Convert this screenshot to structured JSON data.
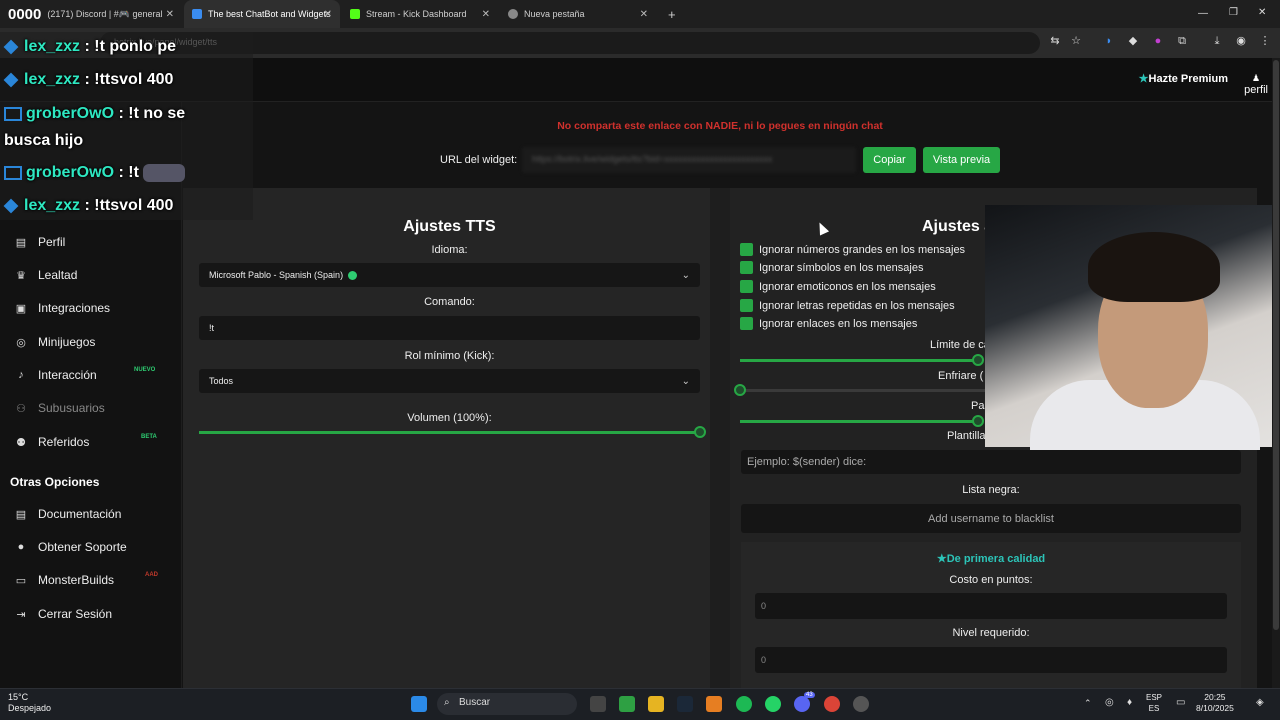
{
  "browser": {
    "tabs": [
      {
        "label": "(2171) Discord | #🎮 general"
      },
      {
        "label": "The best ChatBot and Widgets"
      },
      {
        "label": "Stream - Kick Dashboard"
      },
      {
        "label": "Nueva pestaña"
      }
    ],
    "new_tab_glyph": "+",
    "url": "botrix.live/panel/widget/tts"
  },
  "topnav": {
    "premium_label": "Hazte Premium",
    "profile_label": "perfil"
  },
  "sidebar": {
    "items": [
      {
        "label": "Perfil",
        "icon": "id-card-icon"
      },
      {
        "label": "Lealtad",
        "icon": "trophy-icon"
      },
      {
        "label": "Integraciones",
        "icon": "grid-icon"
      },
      {
        "label": "Minijuegos",
        "icon": "gamepad-icon"
      },
      {
        "label": "Interacción",
        "icon": "music-icon"
      },
      {
        "label": "Subusuarios",
        "icon": "users-icon"
      },
      {
        "label": "Referidos",
        "icon": "referral-icon"
      }
    ],
    "badges": {
      "interaccion": "NUEVO",
      "referidos": "BETA",
      "monsterbuilds": "AAD"
    },
    "section_title": "Otras Opciones",
    "other_items": [
      {
        "label": "Documentación",
        "icon": "document-icon"
      },
      {
        "label": "Obtener Soporte",
        "icon": "support-icon"
      },
      {
        "label": "MonsterBuilds",
        "icon": "monitor-icon"
      },
      {
        "label": "Cerrar Sesión",
        "icon": "logout-icon"
      }
    ]
  },
  "widget": {
    "warning": "No comparta este enlace con NADIE, ni lo pegues en ningún chat",
    "url_label": "URL del widget:",
    "url_value": "https://botrix.live/widgets/tts?bid=xxxxxxxxxxxxxxxxxxxxxxxx",
    "copy_label": "Copiar",
    "preview_label": "Vista previa"
  },
  "tts": {
    "title": "Ajustes TTS",
    "language_label": "Idioma:",
    "language_value": "Microsoft Pablo - Spanish (Spain)",
    "command_label": "Comando:",
    "command_value": "!t",
    "role_label": "Rol mínimo (Kick):",
    "role_value": "Todos",
    "volume_label": "Volumen (100%):",
    "volume_level": 1.0
  },
  "advanced": {
    "title": "Ajustes a",
    "checkboxes": [
      "Ignorar números grandes en los mensajes",
      "Ignorar símbolos en los mensajes",
      "Ignorar emoticonos en los mensajes",
      "Ignorar letras repetidas en los mensajes",
      "Ignorar enlaces en los mensajes"
    ],
    "limit_label": "Límite de ca",
    "cooldown_label": "Enfriare (",
    "pass_label": "Pas",
    "template_label": "Plantilla",
    "template_placeholder": "Ejemplo: $(sender) dice:",
    "blacklist_label": "Lista negra:",
    "blacklist_placeholder": "Add username to blacklist",
    "premium_title": "De primera calidad",
    "points_label": "Costo en puntos:",
    "points_value": "0",
    "level_label": "Nivel requerido:",
    "level_value": "0"
  },
  "chat": [
    {
      "user": "lex_zxz",
      "msg": "!t ponlo pe"
    },
    {
      "user": "lex_zxz",
      "msg": "!ttsvol 400"
    },
    {
      "user": "groberOwO",
      "msg": "!t no se"
    },
    {
      "user": "",
      "msg": "busca hijo"
    },
    {
      "user": "groberOwO",
      "msg": "!t"
    },
    {
      "user": "lex_zxz",
      "msg": "!ttsvol 400"
    }
  ],
  "taskbar": {
    "temperature": "15°C",
    "weather": "Despejado",
    "search_label": "Buscar",
    "lang_top": "ESP",
    "lang_bottom": "ES",
    "time": "20:25",
    "date": "8/10/2025",
    "discord_count": "43"
  },
  "colors": {
    "accent": "#27a745",
    "warning": "#d0312d",
    "teal": "#2cc4b8"
  }
}
